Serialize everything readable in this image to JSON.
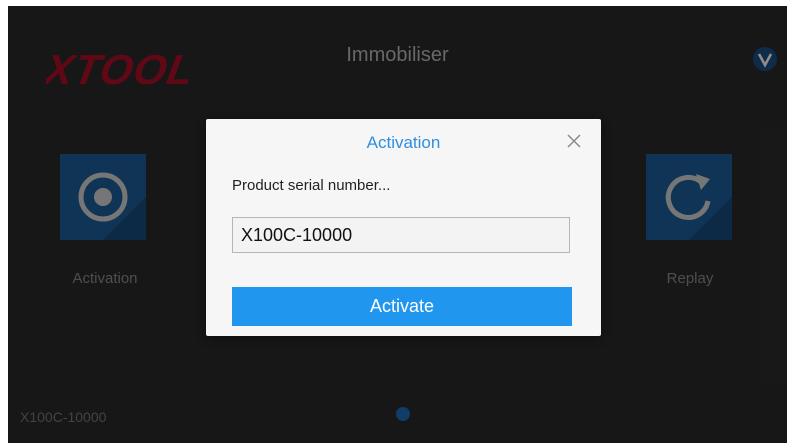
{
  "header": {
    "title": "Immobiliser",
    "logo_text": "XTOOL"
  },
  "tiles": [
    {
      "label": "Activation",
      "icon": "target-icon",
      "color": "#1e5f9c"
    },
    {
      "label": "Replay",
      "icon": "refresh-icon",
      "color": "#1e5f9c"
    }
  ],
  "footer": {
    "serial": "X100C-10000",
    "pages": 1,
    "current_page": 1
  },
  "dialog": {
    "title": "Activation",
    "prompt": "Product serial number...",
    "serial_value": "X100C-10000",
    "button_label": "Activate"
  },
  "colors": {
    "background": "#2b2b2b",
    "accent": "#2196ef",
    "dialog_title": "#2e8fe0",
    "logo_red": "#c8102e"
  }
}
